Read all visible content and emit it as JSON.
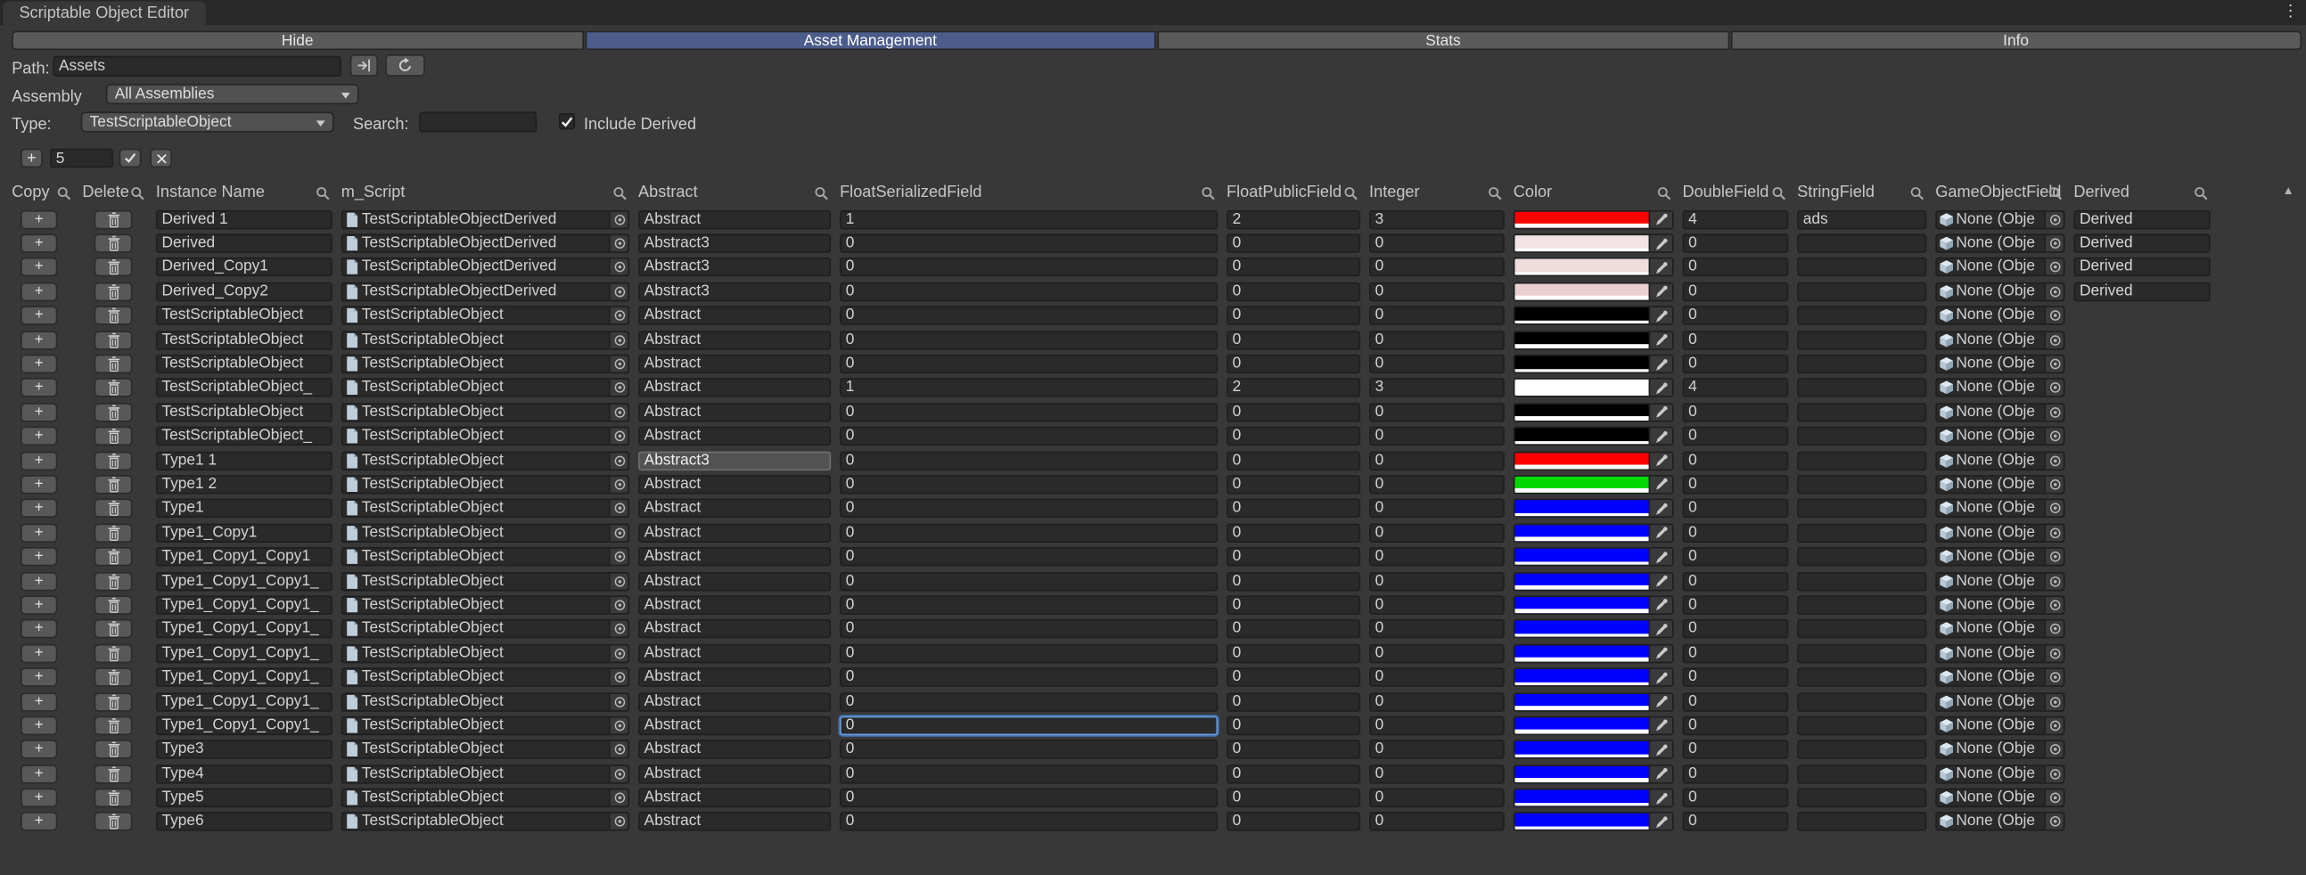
{
  "window": {
    "title": "Scriptable Object Editor"
  },
  "icons": {
    "menu": "⋮",
    "plus": "+",
    "check": "✓",
    "close": "×",
    "scroll_up": "▲"
  },
  "tabs": [
    {
      "label": "Hide",
      "active": false
    },
    {
      "label": "Asset Management",
      "active": true
    },
    {
      "label": "Stats",
      "active": false
    },
    {
      "label": "Info",
      "active": false
    }
  ],
  "filters": {
    "path_label": "Path:",
    "path_value": "Assets",
    "assembly_label": "Assembly",
    "assembly_value": "All Assemblies",
    "type_label": "Type:",
    "type_value": "TestScriptableObject",
    "search_label": "Search:",
    "search_value": "",
    "include_derived_label": "Include Derived",
    "include_derived_checked": true
  },
  "toolbar": {
    "add_label": "+",
    "count_value": "5"
  },
  "table": {
    "copy_button_label": "+",
    "columns": [
      "Copy",
      "Delete",
      "Instance Name",
      "m_Script",
      "Abstract",
      "FloatSerializedField",
      "FloatPublicField",
      "Integer",
      "Color",
      "DoubleField",
      "StringField",
      "GameObjectField",
      "Derived"
    ],
    "rows": [
      {
        "name": "Derived 1",
        "script": "TestScriptableObjectDerived",
        "abstract": "Abstract",
        "float_serialized": "1",
        "float_public": "2",
        "integer": "3",
        "color": "#ff0000",
        "double": "4",
        "string": "ads",
        "game_object": "None (Obje",
        "derived": "Derived"
      },
      {
        "name": "Derived",
        "script": "TestScriptableObjectDerived",
        "abstract": "Abstract3",
        "float_serialized": "0",
        "float_public": "0",
        "integer": "0",
        "color": "#f2e4e4",
        "double": "0",
        "string": "",
        "game_object": "None (Obje",
        "derived": "Derived"
      },
      {
        "name": "Derived_Copy1",
        "script": "TestScriptableObjectDerived",
        "abstract": "Abstract3",
        "float_serialized": "0",
        "float_public": "0",
        "integer": "0",
        "color": "#efdcdc",
        "double": "0",
        "string": "",
        "game_object": "None (Obje",
        "derived": "Derived"
      },
      {
        "name": "Derived_Copy2",
        "script": "TestScriptableObjectDerived",
        "abstract": "Abstract3",
        "float_serialized": "0",
        "float_public": "0",
        "integer": "0",
        "color": "#ead0d0",
        "double": "0",
        "string": "",
        "game_object": "None (Obje",
        "derived": "Derived"
      },
      {
        "name": "TestScriptableObject",
        "script": "TestScriptableObject",
        "abstract": "Abstract",
        "float_serialized": "0",
        "float_public": "0",
        "integer": "0",
        "color": "#000000",
        "double": "0",
        "string": "",
        "game_object": "None (Obje",
        "derived": ""
      },
      {
        "name": "TestScriptableObject",
        "script": "TestScriptableObject",
        "abstract": "Abstract",
        "float_serialized": "0",
        "float_public": "0",
        "integer": "0",
        "color": "#000000",
        "double": "0",
        "string": "",
        "game_object": "None (Obje",
        "derived": ""
      },
      {
        "name": "TestScriptableObject",
        "script": "TestScriptableObject",
        "abstract": "Abstract",
        "float_serialized": "0",
        "float_public": "0",
        "integer": "0",
        "color": "#000000",
        "double": "0",
        "string": "",
        "game_object": "None (Obje",
        "derived": ""
      },
      {
        "name": "TestScriptableObject_",
        "script": "TestScriptableObject",
        "abstract": "Abstract",
        "float_serialized": "1",
        "float_public": "2",
        "integer": "3",
        "color": "#ffffff",
        "double": "4",
        "string": "",
        "game_object": "None (Obje",
        "derived": ""
      },
      {
        "name": "TestScriptableObject",
        "script": "TestScriptableObject",
        "abstract": "Abstract",
        "float_serialized": "0",
        "float_public": "0",
        "integer": "0",
        "color": "#000000",
        "double": "0",
        "string": "",
        "game_object": "None (Obje",
        "derived": ""
      },
      {
        "name": "TestScriptableObject_",
        "script": "TestScriptableObject",
        "abstract": "Abstract",
        "float_serialized": "0",
        "float_public": "0",
        "integer": "0",
        "color": "#000000",
        "double": "0",
        "string": "",
        "game_object": "None (Obje",
        "derived": ""
      },
      {
        "name": "Type1 1",
        "script": "TestScriptableObject",
        "abstract": "Abstract3",
        "abstract_selected": true,
        "float_serialized": "0",
        "float_public": "0",
        "integer": "0",
        "color": "#ff0000",
        "double": "0",
        "string": "",
        "game_object": "None (Obje",
        "derived": ""
      },
      {
        "name": "Type1 2",
        "script": "TestScriptableObject",
        "abstract": "Abstract",
        "float_serialized": "0",
        "float_public": "0",
        "integer": "0",
        "color": "#00d800",
        "double": "0",
        "string": "",
        "game_object": "None (Obje",
        "derived": ""
      },
      {
        "name": "Type1",
        "script": "TestScriptableObject",
        "abstract": "Abstract",
        "float_serialized": "0",
        "float_public": "0",
        "integer": "0",
        "color": "#0000ff",
        "double": "0",
        "string": "",
        "game_object": "None (Obje",
        "derived": ""
      },
      {
        "name": "Type1_Copy1",
        "script": "TestScriptableObject",
        "abstract": "Abstract",
        "float_serialized": "0",
        "float_public": "0",
        "integer": "0",
        "color": "#0000ff",
        "double": "0",
        "string": "",
        "game_object": "None (Obje",
        "derived": ""
      },
      {
        "name": "Type1_Copy1_Copy1",
        "script": "TestScriptableObject",
        "abstract": "Abstract",
        "float_serialized": "0",
        "float_public": "0",
        "integer": "0",
        "color": "#0000ff",
        "double": "0",
        "string": "",
        "game_object": "None (Obje",
        "derived": ""
      },
      {
        "name": "Type1_Copy1_Copy1_",
        "script": "TestScriptableObject",
        "abstract": "Abstract",
        "float_serialized": "0",
        "float_public": "0",
        "integer": "0",
        "color": "#0000ff",
        "double": "0",
        "string": "",
        "game_object": "None (Obje",
        "derived": ""
      },
      {
        "name": "Type1_Copy1_Copy1_",
        "script": "TestScriptableObject",
        "abstract": "Abstract",
        "float_serialized": "0",
        "float_public": "0",
        "integer": "0",
        "color": "#0000ff",
        "double": "0",
        "string": "",
        "game_object": "None (Obje",
        "derived": ""
      },
      {
        "name": "Type1_Copy1_Copy1_",
        "script": "TestScriptableObject",
        "abstract": "Abstract",
        "float_serialized": "0",
        "float_public": "0",
        "integer": "0",
        "color": "#0000ff",
        "double": "0",
        "string": "",
        "game_object": "None (Obje",
        "derived": ""
      },
      {
        "name": "Type1_Copy1_Copy1_",
        "script": "TestScriptableObject",
        "abstract": "Abstract",
        "float_serialized": "0",
        "float_public": "0",
        "integer": "0",
        "color": "#0000ff",
        "double": "0",
        "string": "",
        "game_object": "None (Obje",
        "derived": ""
      },
      {
        "name": "Type1_Copy1_Copy1_",
        "script": "TestScriptableObject",
        "abstract": "Abstract",
        "float_serialized": "0",
        "float_public": "0",
        "integer": "0",
        "color": "#0000ff",
        "double": "0",
        "string": "",
        "game_object": "None (Obje",
        "derived": ""
      },
      {
        "name": "Type1_Copy1_Copy1_",
        "script": "TestScriptableObject",
        "abstract": "Abstract",
        "float_serialized": "0",
        "float_public": "0",
        "integer": "0",
        "color": "#0000ff",
        "double": "0",
        "string": "",
        "game_object": "None (Obje",
        "derived": ""
      },
      {
        "name": "Type1_Copy1_Copy1_",
        "script": "TestScriptableObject",
        "abstract": "Abstract",
        "float_serialized": "0",
        "float_focused": true,
        "float_public": "0",
        "integer": "0",
        "color": "#0000ff",
        "double": "0",
        "string": "",
        "game_object": "None (Obje",
        "derived": ""
      },
      {
        "name": "Type3",
        "script": "TestScriptableObject",
        "abstract": "Abstract",
        "float_serialized": "0",
        "float_public": "0",
        "integer": "0",
        "color": "#0000ff",
        "double": "0",
        "string": "",
        "game_object": "None (Obje",
        "derived": ""
      },
      {
        "name": "Type4",
        "script": "TestScriptableObject",
        "abstract": "Abstract",
        "float_serialized": "0",
        "float_public": "0",
        "integer": "0",
        "color": "#0000ff",
        "double": "0",
        "string": "",
        "game_object": "None (Obje",
        "derived": ""
      },
      {
        "name": "Type5",
        "script": "TestScriptableObject",
        "abstract": "Abstract",
        "float_serialized": "0",
        "float_public": "0",
        "integer": "0",
        "color": "#0000ff",
        "double": "0",
        "string": "",
        "game_object": "None (Obje",
        "derived": ""
      },
      {
        "name": "Type6",
        "script": "TestScriptableObject",
        "abstract": "Abstract",
        "float_serialized": "0",
        "float_public": "0",
        "integer": "0",
        "color": "#0000ff",
        "double": "0",
        "string": "",
        "game_object": "None (Obje",
        "derived": ""
      }
    ]
  }
}
